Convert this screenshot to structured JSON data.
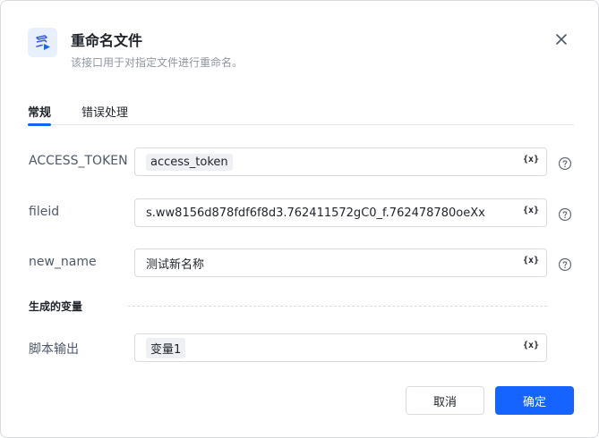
{
  "dialog": {
    "title": "重命名文件",
    "subtitle": "该接口用于对指定文件进行重命名。",
    "icon": "file-rename-icon",
    "accent_color": "#1664ff"
  },
  "tabs": [
    {
      "label": "常规",
      "active": true
    },
    {
      "label": "错误处理",
      "active": false
    }
  ],
  "fields": {
    "access_token": {
      "label": "ACCESS_TOKEN",
      "value": "access_token"
    },
    "fileid": {
      "label": "fileid",
      "value": "s.ww8156d878fdf6f8d3.762411572gC0_f.762478780oeXx"
    },
    "new_name": {
      "label": "new_name",
      "value": "测试新名称"
    }
  },
  "variable_button": "{x}",
  "output_section": {
    "title": "生成的变量",
    "label": "脚本输出",
    "value": "变量1"
  },
  "buttons": {
    "cancel": "取消",
    "confirm": "确定"
  }
}
